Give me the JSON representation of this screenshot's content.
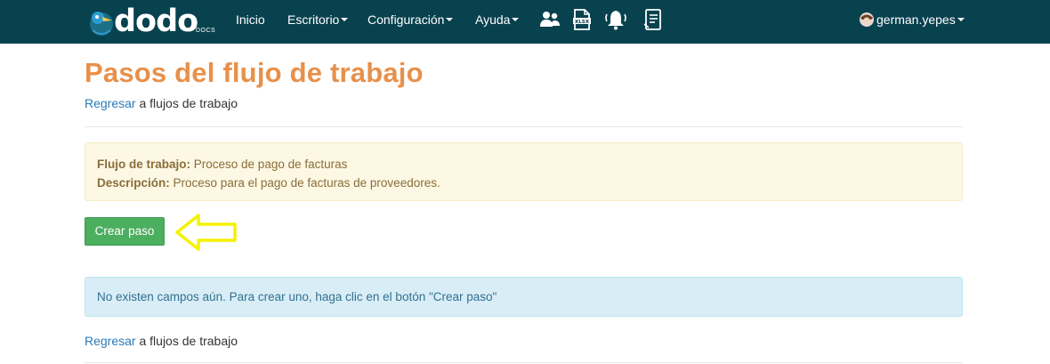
{
  "navbar": {
    "brand": {
      "word": "dodo",
      "sub": "DOCS",
      "mark": "®"
    },
    "menu": [
      {
        "label": "Inicio",
        "has_caret": false
      },
      {
        "label": "Escritorio",
        "has_caret": true
      },
      {
        "label": "Configuración",
        "has_caret": true
      },
      {
        "label": "Ayuda",
        "has_caret": true
      }
    ],
    "icons": [
      "users-icon",
      "xlsx-file-icon",
      "bell-icon",
      "document-list-icon"
    ],
    "user": {
      "name": "german.yepes",
      "avatar_icon": "user-avatar-icon"
    }
  },
  "page": {
    "title": "Pasos del flujo de trabajo",
    "back_link": {
      "link_text": "Regresar",
      "rest_text": " a flujos de trabajo"
    },
    "workflow": {
      "flow_label": "Flujo de trabajo:",
      "flow_value": " Proceso de pago de facturas",
      "desc_label": "Descripción:",
      "desc_value": " Proceso para el pago de facturas de proveedores."
    },
    "create_button": "Crear paso",
    "empty_message": "No existen campos aún. Para crear uno, haga clic en el botón \"Crear paso\""
  },
  "colors": {
    "navbar_bg": "#08424f",
    "title": "#e8904a",
    "link": "#2a7ab7",
    "button_green": "#4cae5f",
    "annotation_arrow": "#ffff00"
  }
}
